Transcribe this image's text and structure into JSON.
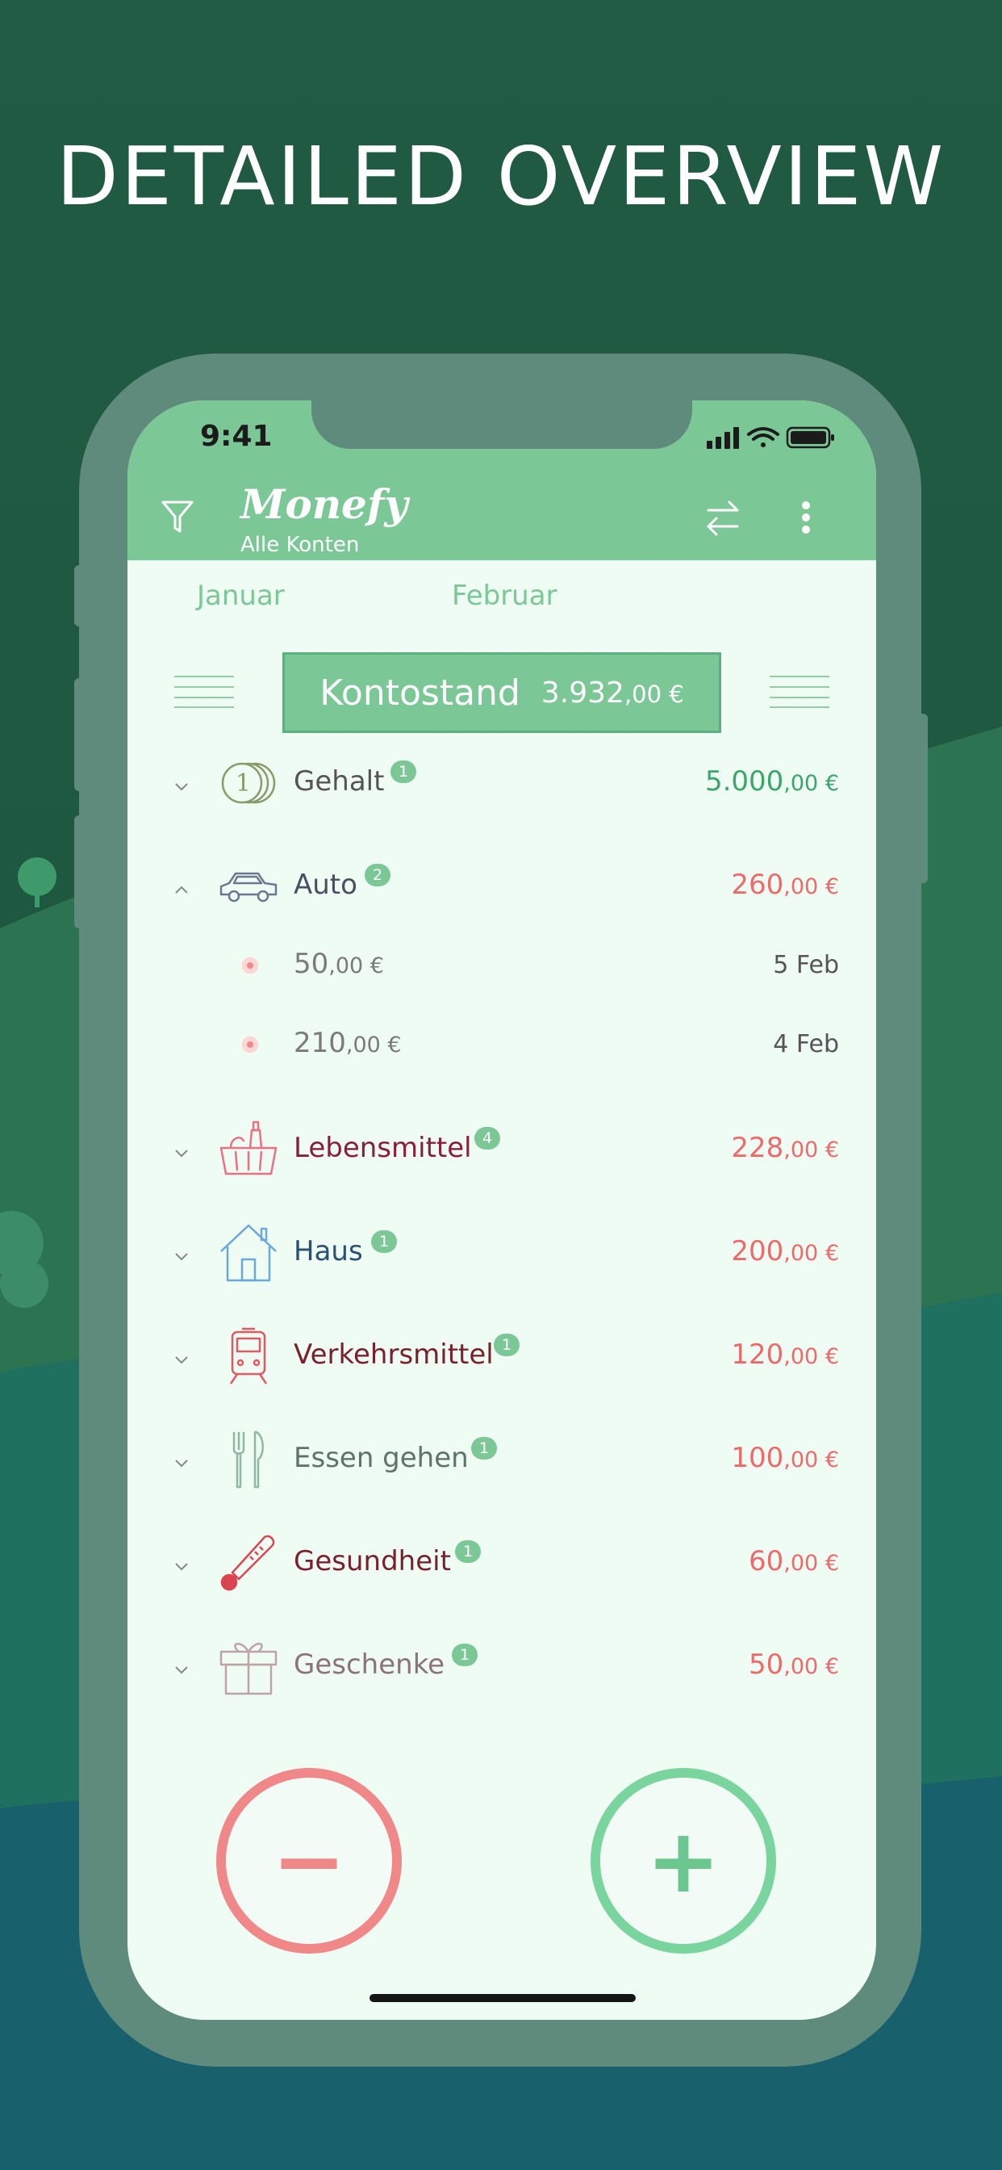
{
  "headline": "DETAILED OVERVIEW",
  "status_bar": {
    "time": "9:41"
  },
  "app": {
    "logo": "Monefy",
    "account": "Alle Konten"
  },
  "months": {
    "previous": "Januar",
    "current": "Februar"
  },
  "balance": {
    "label": "Kontostand",
    "value": "3.932",
    "cents": ",00 €"
  },
  "categories": [
    {
      "name": "Gehalt",
      "count": "1",
      "amount": "5.000",
      "cents": ",00 €",
      "icon": "coins-icon",
      "expanded": false
    },
    {
      "name": "Auto",
      "count": "2",
      "amount": "260",
      "cents": ",00 €",
      "icon": "car-icon",
      "expanded": true
    },
    {
      "name": "Lebensmittel",
      "count": "4",
      "amount": "228",
      "cents": ",00 €",
      "icon": "grocery-basket-icon",
      "expanded": false
    },
    {
      "name": "Haus",
      "count": "1",
      "amount": "200",
      "cents": ",00 €",
      "icon": "house-icon",
      "expanded": false
    },
    {
      "name": "Verkehrsmittel",
      "count": "1",
      "amount": "120",
      "cents": ",00 €",
      "icon": "train-icon",
      "expanded": false
    },
    {
      "name": "Essen gehen",
      "count": "1",
      "amount": "100",
      "cents": ",00 €",
      "icon": "cutlery-icon",
      "expanded": false
    },
    {
      "name": "Gesundheit",
      "count": "1",
      "amount": "60",
      "cents": ",00 €",
      "icon": "thermometer-icon",
      "expanded": false
    },
    {
      "name": "Geschenke",
      "count": "1",
      "amount": "50",
      "cents": ",00 €",
      "icon": "gift-icon",
      "expanded": false
    }
  ],
  "auto_transactions": [
    {
      "amount": "50",
      "cents": ",00 €",
      "date": "5 Feb"
    },
    {
      "amount": "210",
      "cents": ",00 €",
      "date": "4 Feb"
    }
  ],
  "buttons": {
    "expense": "−",
    "income": "+"
  },
  "colors": {
    "brand_green": "#7cc796",
    "income_green": "#3aa66a",
    "expense_red": "#ee6a6a",
    "screen_bg": "#eefcf3"
  }
}
